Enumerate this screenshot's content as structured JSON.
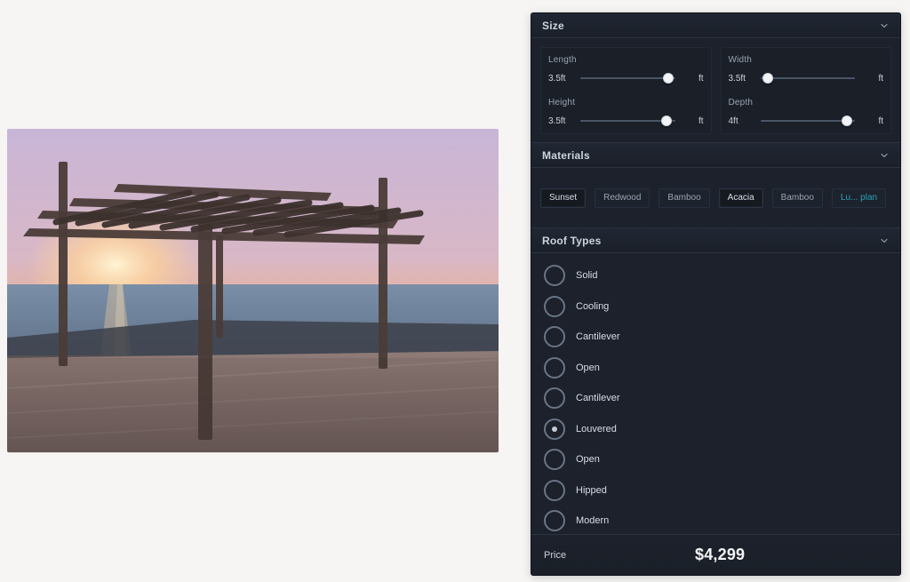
{
  "panel": {
    "sections": {
      "size": {
        "title": "Size",
        "left": {
          "length": {
            "label": "Length",
            "value": "3.5ft",
            "unit": "ft",
            "fraction": 0.93
          },
          "height": {
            "label": "Height",
            "value": "3.5ft",
            "unit": "ft",
            "fraction": 0.91
          }
        },
        "right": {
          "width": {
            "label": "Width",
            "value": "3.5ft",
            "unit": "ft",
            "fraction": 0.08
          },
          "depth": {
            "label": "Depth",
            "value": "4ft",
            "unit": "ft",
            "fraction": 0.92
          }
        }
      },
      "materials": {
        "title": "Materials",
        "chips": [
          {
            "label": "Sunset",
            "selected": true,
            "accent": false
          },
          {
            "label": "Redwood",
            "selected": false,
            "accent": false
          },
          {
            "label": "Bamboo",
            "selected": false,
            "accent": false
          },
          {
            "label": "Acacia",
            "selected": true,
            "accent": false
          },
          {
            "label": "Bamboo",
            "selected": false,
            "accent": false
          },
          {
            "label": "Lu... plan",
            "selected": false,
            "accent": true
          }
        ]
      },
      "roof_types": {
        "title": "Roof Types",
        "options": [
          {
            "label": "Solid",
            "checked": false
          },
          {
            "label": "Cooling",
            "checked": false
          },
          {
            "label": "Cantilever",
            "checked": false
          },
          {
            "label": "Open",
            "checked": false
          },
          {
            "label": "Cantilever",
            "checked": false
          },
          {
            "label": "Louvered",
            "checked": true
          },
          {
            "label": "Open",
            "checked": false
          },
          {
            "label": "Hipped",
            "checked": false
          },
          {
            "label": "Modern",
            "checked": false
          }
        ]
      }
    },
    "footer": {
      "price_label": "Price",
      "price_value": "$4,299"
    }
  }
}
